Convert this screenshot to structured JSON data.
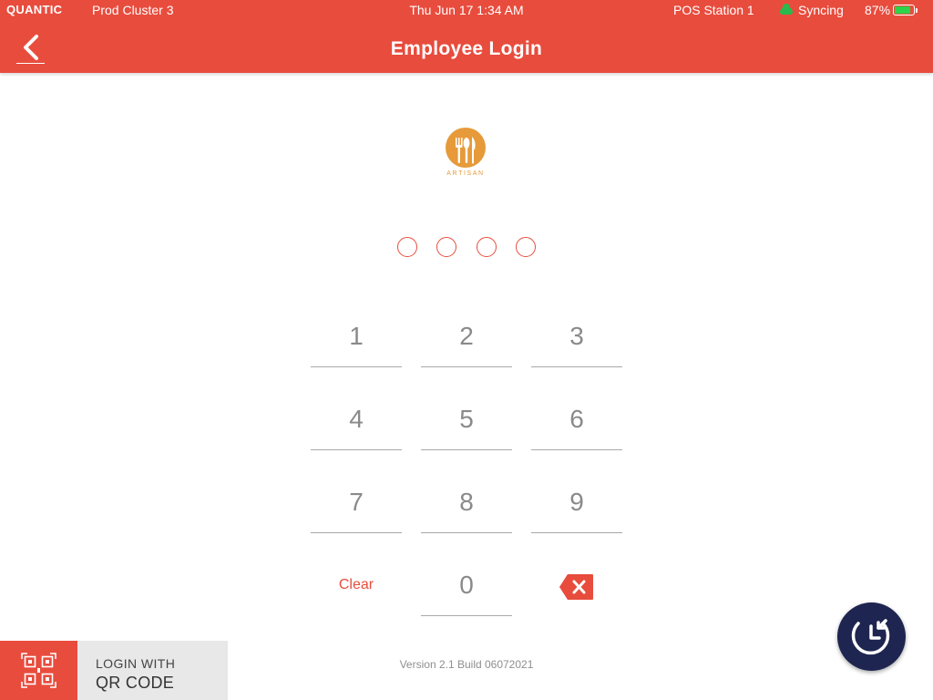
{
  "status_bar": {
    "brand": "QUANTIC",
    "cluster": "Prod Cluster 3",
    "datetime": "Thu Jun 17 1:34 AM",
    "station": "POS Station 1",
    "sync_status": "Syncing",
    "battery": "87%",
    "battery_level": 0.87
  },
  "header": {
    "title": "Employee Login",
    "back_icon": "chevron-left-icon"
  },
  "logo": {
    "name": "ARTISAN"
  },
  "pin": {
    "length": 4,
    "entered": 0
  },
  "keypad": {
    "keys": [
      "1",
      "2",
      "3",
      "4",
      "5",
      "6",
      "7",
      "8",
      "9"
    ],
    "zero": "0",
    "clear_label": "Clear",
    "backspace_icon": "backspace-icon"
  },
  "qr_login": {
    "line1": "LOGIN WITH",
    "line2": "QR CODE",
    "icon": "qr-code-icon"
  },
  "version": "Version 2.1 Build 06072021",
  "fab_icon": "clock-in-icon",
  "colors": {
    "accent": "#e84c3d",
    "fab": "#1e2550",
    "logo": "#e69a3a",
    "battery": "#2bd24a",
    "sync": "#2bb84f"
  }
}
